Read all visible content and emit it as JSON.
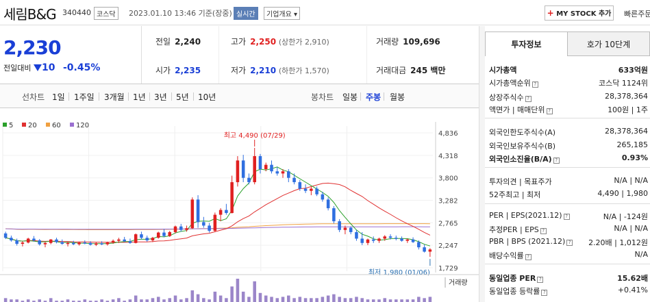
{
  "header": {
    "name": "세림B&G",
    "code": "340440",
    "market_tag": "코스닥",
    "datetime": "2023.01.10 13:46 기준(장중)",
    "realtime_tag": "실시간",
    "company_tag": "기업개요",
    "company_arrow": "▾",
    "my_stock_plus": "+",
    "my_stock_label": "MY STOCK 추가",
    "quick_order": "빠른주문"
  },
  "price": {
    "current": "2,230",
    "change_label": "전일대비",
    "change_value": "10",
    "change_pct": "-0.45%"
  },
  "stats": {
    "prev_label": "전일",
    "prev": "2,240",
    "high_label": "고가",
    "high": "2,250",
    "upper_limit": "(상한가 2,910)",
    "volume_label": "거래량",
    "volume": "109,696",
    "open_label": "시가",
    "open": "2,235",
    "low_label": "저가",
    "low": "2,210",
    "lower_limit": "(하한가 1,570)",
    "amount_label": "거래대금",
    "amount": "245 백만"
  },
  "tabs": {
    "line_label": "선차트",
    "line_items": [
      "1일",
      "1주일",
      "3개월",
      "1년",
      "3년",
      "5년",
      "10년"
    ],
    "candle_label": "봉차트",
    "candle_items": [
      "일봉",
      "주봉",
      "월봉"
    ]
  },
  "colors": {
    "up": "#e02020",
    "down": "#2f6fe0",
    "ma5": "#2aa02a",
    "ma20": "#e03030",
    "ma60": "#f0a040",
    "ma120": "#9a6fd0"
  },
  "chart_data": {
    "type": "candlestick",
    "legend": [
      "5",
      "20",
      "60",
      "120"
    ],
    "y_ticks": [
      "4,836",
      "4,318",
      "3,800",
      "3,282",
      "2,765",
      "2,247",
      "1,729"
    ],
    "ylim": [
      1729,
      4836
    ],
    "annotation_high": "최고 4,490 (07/29)",
    "annotation_low": "최저 1,980 (01/06)",
    "volume_label": "거래량",
    "candles": [
      [
        2520,
        2560,
        2390,
        2420
      ],
      [
        2420,
        2470,
        2330,
        2360
      ],
      [
        2360,
        2400,
        2240,
        2280
      ],
      [
        2280,
        2340,
        2220,
        2310
      ],
      [
        2310,
        2420,
        2290,
        2400
      ],
      [
        2400,
        2460,
        2330,
        2360
      ],
      [
        2360,
        2390,
        2240,
        2270
      ],
      [
        2270,
        2320,
        2200,
        2300
      ],
      [
        2300,
        2390,
        2270,
        2380
      ],
      [
        2380,
        2420,
        2290,
        2320
      ],
      [
        2320,
        2380,
        2260,
        2280
      ],
      [
        2280,
        2330,
        2220,
        2300
      ],
      [
        2300,
        2350,
        2250,
        2270
      ],
      [
        2270,
        2330,
        2240,
        2310
      ],
      [
        2310,
        2360,
        2270,
        2300
      ],
      [
        2300,
        2340,
        2240,
        2260
      ],
      [
        2260,
        2320,
        2230,
        2290
      ],
      [
        2290,
        2340,
        2250,
        2270
      ],
      [
        2270,
        2330,
        2240,
        2310
      ],
      [
        2310,
        2380,
        2280,
        2350
      ],
      [
        2350,
        2420,
        2300,
        2380
      ],
      [
        2380,
        2440,
        2320,
        2340
      ],
      [
        2340,
        2400,
        2280,
        2300
      ],
      [
        2300,
        2520,
        2290,
        2500
      ],
      [
        2500,
        2560,
        2380,
        2420
      ],
      [
        2420,
        2470,
        2330,
        2360
      ],
      [
        2360,
        2440,
        2320,
        2420
      ],
      [
        2420,
        2560,
        2400,
        2540
      ],
      [
        2540,
        2620,
        2430,
        2460
      ],
      [
        2460,
        2580,
        2440,
        2550
      ],
      [
        2550,
        2700,
        2520,
        2680
      ],
      [
        2680,
        2740,
        2560,
        2600
      ],
      [
        2600,
        2700,
        2560,
        2640
      ],
      [
        2640,
        3350,
        2620,
        3300
      ],
      [
        3300,
        3400,
        2650,
        2780
      ],
      [
        2780,
        2900,
        2650,
        2700
      ],
      [
        2700,
        2760,
        2540,
        2580
      ],
      [
        2580,
        3000,
        2550,
        2950
      ],
      [
        2950,
        3100,
        2800,
        3060
      ],
      [
        3060,
        3200,
        2950,
        2990
      ],
      [
        2990,
        3850,
        2980,
        3700
      ],
      [
        3700,
        4300,
        3600,
        4200
      ],
      [
        4200,
        4330,
        3700,
        3800
      ],
      [
        3800,
        3900,
        3650,
        3700
      ],
      [
        3700,
        4490,
        3650,
        4300
      ],
      [
        4300,
        4350,
        3900,
        4000
      ],
      [
        4000,
        4150,
        3950,
        4100
      ],
      [
        4100,
        4200,
        3900,
        3950
      ],
      [
        3950,
        4050,
        3850,
        3900
      ],
      [
        3900,
        4000,
        3800,
        3950
      ],
      [
        3950,
        4000,
        3700,
        3800
      ],
      [
        3800,
        3900,
        3650,
        3700
      ],
      [
        3700,
        3750,
        3500,
        3550
      ],
      [
        3550,
        3650,
        3450,
        3500
      ],
      [
        3500,
        3600,
        3400,
        3550
      ],
      [
        3550,
        3600,
        3380,
        3420
      ],
      [
        3420,
        3480,
        3250,
        3300
      ],
      [
        3300,
        3350,
        3050,
        3100
      ],
      [
        3100,
        3150,
        2750,
        2800
      ],
      [
        2800,
        2850,
        2550,
        2600
      ],
      [
        2600,
        2700,
        2500,
        2650
      ],
      [
        2650,
        2680,
        2500,
        2550
      ],
      [
        2550,
        2600,
        2350,
        2400
      ],
      [
        2400,
        2550,
        2250,
        2300
      ],
      [
        2300,
        2400,
        2250,
        2380
      ],
      [
        2380,
        2450,
        2300,
        2350
      ],
      [
        2350,
        2420,
        2300,
        2400
      ],
      [
        2400,
        2480,
        2350,
        2450
      ],
      [
        2450,
        2500,
        2380,
        2420
      ],
      [
        2420,
        2470,
        2360,
        2400
      ],
      [
        2400,
        2450,
        2330,
        2350
      ],
      [
        2350,
        2400,
        2300,
        2380
      ],
      [
        2380,
        2430,
        2300,
        2320
      ],
      [
        2320,
        2360,
        2150,
        2200
      ],
      [
        2200,
        2260,
        2080,
        2100
      ],
      [
        2100,
        2180,
        1980,
        2150
      ]
    ],
    "volume": [
      3,
      2,
      2,
      1,
      2,
      1,
      2,
      1,
      3,
      1,
      1,
      2,
      1,
      1,
      2,
      1,
      1,
      2,
      1,
      2,
      3,
      1,
      2,
      5,
      2,
      2,
      3,
      4,
      2,
      3,
      5,
      2,
      3,
      9,
      6,
      3,
      2,
      8,
      5,
      3,
      12,
      18,
      8,
      4,
      16,
      7,
      5,
      4,
      3,
      4,
      5,
      3,
      4,
      3,
      3,
      3,
      4,
      5,
      6,
      4,
      3,
      3,
      4,
      3,
      2,
      2,
      2,
      3,
      2,
      2,
      2,
      2,
      2,
      4,
      3,
      4
    ]
  },
  "side": {
    "tab_info": "투자정보",
    "tab_hoga": "호가 10단계",
    "market_cap_label": "시가총액",
    "market_cap": "633억원",
    "market_cap_rank_label": "시가총액순위",
    "market_cap_rank": "코스닥 1124위",
    "shares_label": "상장주식수",
    "shares": "28,378,364",
    "par_label": "액면가 | 매매단위",
    "par": "100원 | 1주",
    "foreign_limit_label": "외국인한도주식수(A)",
    "foreign_limit": "28,378,364",
    "foreign_hold_label": "외국인보유주식수(B)",
    "foreign_hold": "265,185",
    "foreign_ratio_label": "외국인소진율(B/A)",
    "foreign_ratio": "0.93%",
    "opinion_label": "투자의견 | 목표주가",
    "opinion": "N/A | N/A",
    "week52_label": "52주최고 | 최저",
    "week52": "4,490 | 1,980",
    "per_label": "PER | EPS(2021.12)",
    "per": "N/A | -124원",
    "est_per_label": "추정PER | EPS",
    "est_per": "N/A | N/A",
    "pbr_label": "PBR | BPS (2021.12)",
    "pbr": "2.20배 | 1,012원",
    "div_label": "배당수익률",
    "div": "N/A",
    "ind_per_label": "동일업종 PER",
    "ind_per": "15.62배",
    "ind_chg_label": "동일업종 등락률",
    "ind_chg": "+0.41%"
  }
}
